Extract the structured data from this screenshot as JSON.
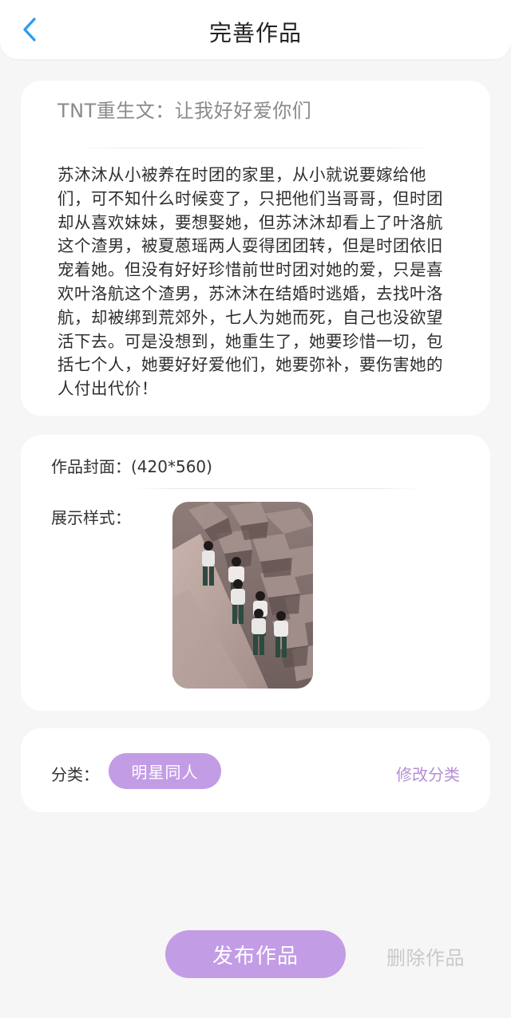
{
  "header": {
    "title": "完善作品",
    "back_icon": "chevron-left-icon"
  },
  "work": {
    "title": "TNT重生文：让我好好爱你们",
    "synopsis": "苏沐沐从小被养在时团的家里，从小就说要嫁给他们，可不知什么时候变了，只把他们当哥哥，但时团却从喜欢妹妹，要想娶她，但苏沐沐却看上了叶洛航这个渣男，被夏蒽瑶两人耍得团团转，但是时团依旧宠着她。但没有好好珍惜前世时团对她的爱，只是喜欢叶洛航这个渣男，苏沐沐在结婚时逃婚，去找叶洛航，却被绑到荒郊外，七人为她而死，自己也没欲望活下去。可是没想到，她重生了，她要珍惜一切，包括七个人，她要好好爱他们，她要弥补，要伤害她的人付出代价！"
  },
  "cover": {
    "label": "作品封面：(420*560)",
    "style_label": "展示样式："
  },
  "category": {
    "label": "分类：",
    "value": "明星同人",
    "modify_label": "修改分类"
  },
  "actions": {
    "publish_label": "发布作品",
    "delete_label": "删除作品"
  },
  "colors": {
    "accent": "#c39ce6",
    "accent_text": "#b48fd6",
    "back_icon": "#2b9bf0",
    "page_bg": "#f6f6f6",
    "delete_text": "#c9c9c9"
  }
}
